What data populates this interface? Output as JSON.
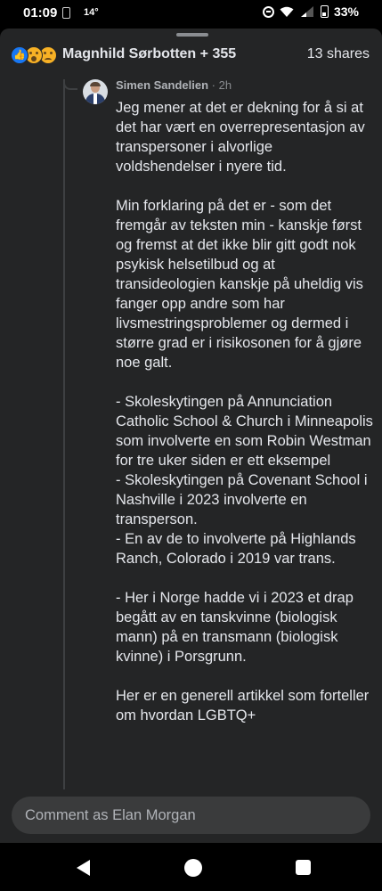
{
  "status_bar": {
    "time": "01:09",
    "temperature": "14°",
    "battery": "33%"
  },
  "header": {
    "reactions": [
      "like-icon",
      "wow-icon",
      "sad-icon"
    ],
    "reactors": "Magnhild Sørbotten + 355",
    "shares": "13 shares"
  },
  "comment": {
    "author": "Simen Sandelien",
    "separator": "·",
    "time": "2h",
    "paragraphs": [
      "Jeg mener at det er dekning for å si at det har vært en overrepresentasjon av transpersoner i alvorlige voldshendelser i nyere tid.",
      "Min forklaring på det er - som det fremgår av teksten min - kanskje først og fremst at det ikke blir gitt godt nok psykisk helsetilbud og at transideologien kanskje på uheldig vis fanger opp andre som har livsmestringsproblemer og dermed i større grad er i risikosonen for å gjøre noe galt."
    ],
    "list": [
      "- Skoleskytingen på Annunciation Catholic School & Church i Minneapolis som involverte en som Robin Westman for tre uker siden er ett eksempel",
      "- Skoleskytingen på Covenant School i Nashville i 2023 involverte en transperson.",
      "- En av de to involverte på Highlands Ranch, Colorado i 2019 var trans."
    ],
    "paragraph_norway": "- Her i Norge hadde vi i 2023 et drap begått av en tanskvinne (biologisk mann) på en transmann (biologisk kvinne) i Porsgrunn.",
    "paragraph_last": "Her er en generell artikkel som forteller om hvordan LGBTQ+"
  },
  "comment_input": {
    "placeholder": "Comment as Elan Morgan"
  }
}
